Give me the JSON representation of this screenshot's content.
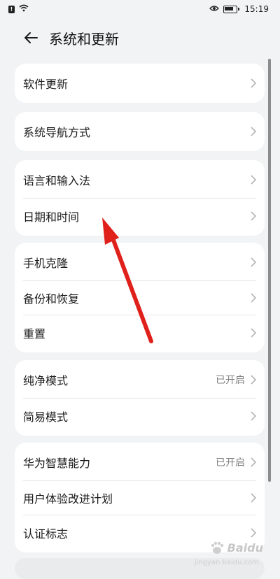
{
  "status_bar": {
    "time": "15:19",
    "left_icons": [
      "alert-icon",
      "wifi-icon"
    ],
    "right_icons": [
      "eye-icon",
      "battery-icon"
    ]
  },
  "header": {
    "title": "系统和更新",
    "back_icon": "arrow-left-icon"
  },
  "groups": [
    {
      "items": [
        {
          "label": "软件更新",
          "value": ""
        }
      ]
    },
    {
      "items": [
        {
          "label": "系统导航方式",
          "value": ""
        }
      ]
    },
    {
      "items": [
        {
          "label": "语言和输入法",
          "value": ""
        },
        {
          "label": "日期和时间",
          "value": ""
        }
      ]
    },
    {
      "items": [
        {
          "label": "手机克隆",
          "value": ""
        },
        {
          "label": "备份和恢复",
          "value": ""
        },
        {
          "label": "重置",
          "value": ""
        }
      ]
    },
    {
      "items": [
        {
          "label": "纯净模式",
          "value": "已开启"
        },
        {
          "label": "简易模式",
          "value": ""
        }
      ]
    },
    {
      "items": [
        {
          "label": "华为智慧能力",
          "value": "已开启"
        },
        {
          "label": "用户体验改进计划",
          "value": ""
        },
        {
          "label": "认证标志",
          "value": ""
        }
      ]
    }
  ],
  "annotation": {
    "color": "#e0201b",
    "icon": "red-arrow"
  },
  "watermark": {
    "brand": "Baidu",
    "sub": "jingyan.baidu.com",
    "icon": "paw-icon"
  }
}
